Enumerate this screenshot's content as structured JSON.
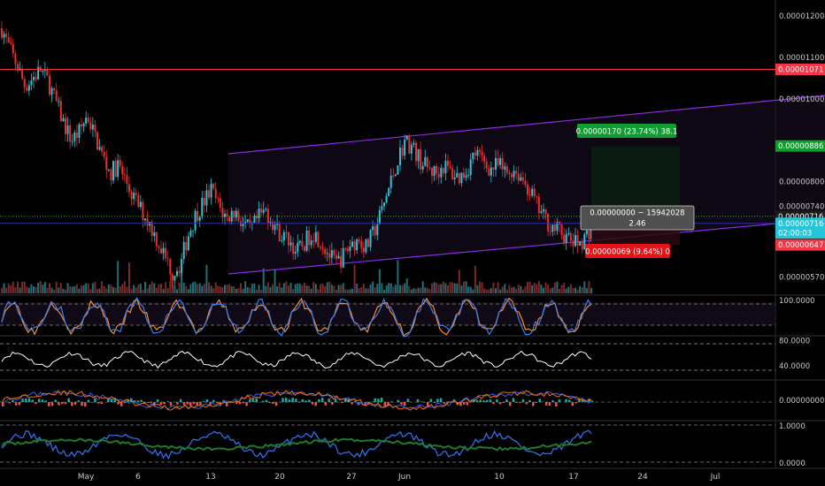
{
  "chart_data": {
    "type": "candlestick",
    "price_axis": {
      "ticks": [
        "0.00001200",
        "0.00001100",
        "0.00001000",
        "0.00000800",
        "0.00000740",
        "0.00000570"
      ],
      "tick_values": [
        1.2e-05,
        1.1e-05,
        1e-05,
        8e-06,
        7.4e-06,
        5.7e-06
      ],
      "ylim": [
        5.3e-06,
        1.23e-05
      ]
    },
    "x_axis": {
      "labels": [
        "May",
        "6",
        "13",
        "20",
        "27",
        "Jun",
        "10",
        "17",
        "24",
        "Jul"
      ]
    },
    "horizontal_line": {
      "value": 1.071e-05,
      "label": "0.00001071",
      "color": "#f23645"
    },
    "price_badges": [
      {
        "label": "0.00000886",
        "value": 8.86e-06,
        "color": "#0e9e2e"
      },
      {
        "label": "0.00000716",
        "value": 7.16e-06,
        "color": "#1c1c1c"
      },
      {
        "label": "0.00000716",
        "value": 6.99e-06,
        "color": "#26c6da"
      },
      {
        "label": "02:00:03",
        "value": 6.76e-06,
        "color": "#26c6da"
      },
      {
        "label": "0.00000647",
        "value": 6.47e-06,
        "color": "#f23645"
      }
    ],
    "position_tool": {
      "target_label": "0.00000170 (23.74%) 38.1",
      "stop_label": "0.00000069 (9.64%) 0",
      "tooltip_line1": "0.00000000 ~ 15942028",
      "tooltip_line2": "2.46",
      "entry": 7.16e-06,
      "target": 8.86e-06,
      "stop": 6.47e-06
    },
    "price_series": [
      1.17e-05,
      1.12e-05,
      1.08e-05,
      1.03e-05,
      1.05e-05,
      1.07e-05,
      1.04e-05,
      9.9e-06,
      9.4e-06,
      9e-06,
      9.2e-06,
      9.6e-06,
      9.1e-06,
      8.6e-06,
      8.2e-06,
      8.4e-06,
      8e-06,
      7.6e-06,
      7.3e-06,
      7e-06,
      6.6e-06,
      6.2e-06,
      5.8e-06,
      6e-06,
      6.7e-06,
      7.2e-06,
      7.5e-06,
      7.8e-06,
      7.4e-06,
      7.1e-06,
      7.3e-06,
      7e-06,
      6.8e-06,
      7.1e-06,
      7.3e-06,
      7e-06,
      6.7e-06,
      6.6e-06,
      6.3e-06,
      6.5e-06,
      6.8e-06,
      6.6e-06,
      6.3e-06,
      6e-06,
      6.2e-06,
      6.5e-06,
      6.6e-06,
      6.4e-06,
      6.8e-06,
      7.3e-06,
      7.9e-06,
      8.5e-06,
      9e-06,
      8.8e-06,
      8.5e-06,
      8.3e-06,
      8.2e-06,
      8.4e-06,
      8.2e-06,
      8.1e-06,
      8.3e-06,
      8.7e-06,
      8.5e-06,
      8.3e-06,
      8.4e-06,
      8.2e-06,
      8.3e-06,
      8.1e-06,
      7.8e-06,
      7.4e-06,
      7.1e-06,
      6.9e-06,
      6.8e-06,
      6.6e-06,
      6.5e-06,
      6.6e-06,
      6.9e-06
    ],
    "panels": [
      {
        "name": "stoch",
        "ticks": [
          "100.0000"
        ],
        "tick_values": [
          100
        ],
        "ylim": [
          0,
          110
        ],
        "series": []
      },
      {
        "name": "rsi",
        "ticks": [
          "80.0000",
          "40.0000"
        ],
        "tick_values": [
          80,
          40
        ],
        "ylim": [
          20,
          85
        ],
        "series": []
      },
      {
        "name": "macd",
        "ticks": [
          "0.00000000"
        ],
        "tick_values": [
          0
        ],
        "ylim": [
          -1,
          1
        ],
        "series": []
      },
      {
        "name": "oscillator",
        "ticks": [
          "1.0000",
          "0.0000"
        ],
        "tick_values": [
          1,
          0
        ],
        "ylim": [
          -0.1,
          1.1
        ],
        "series": []
      }
    ]
  }
}
